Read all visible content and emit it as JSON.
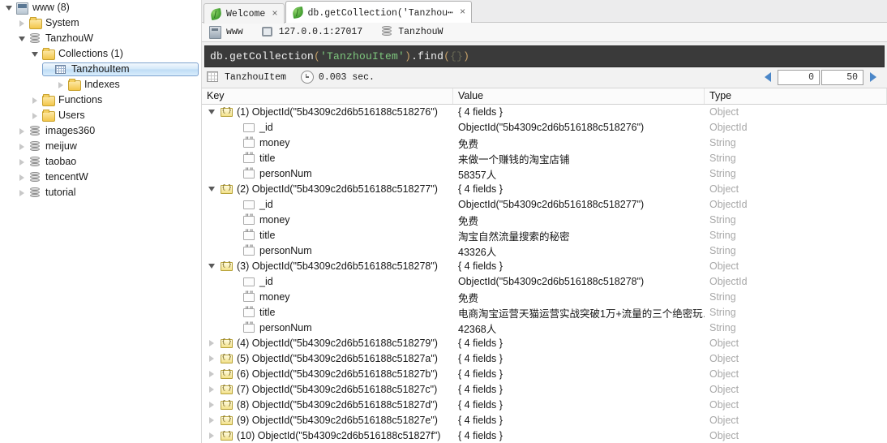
{
  "sidebar": {
    "items": [
      {
        "label": "www (8)",
        "icon": "server-icon",
        "indent": 0,
        "state": "expanded",
        "selected": false
      },
      {
        "label": "System",
        "icon": "folder-icon",
        "indent": 1,
        "state": "collapsed",
        "selected": false
      },
      {
        "label": "TanzhouW",
        "icon": "database-icon",
        "indent": 1,
        "state": "expanded",
        "selected": false
      },
      {
        "label": "Collections (1)",
        "icon": "folder-icon",
        "indent": 2,
        "state": "expanded",
        "selected": false
      },
      {
        "label": "TanzhouItem",
        "icon": "collection-icon",
        "indent": 3,
        "state": "expanded",
        "selected": true
      },
      {
        "label": "Indexes",
        "icon": "folder-icon",
        "indent": 4,
        "state": "collapsed",
        "selected": false
      },
      {
        "label": "Functions",
        "icon": "folder-icon",
        "indent": 2,
        "state": "collapsed",
        "selected": false
      },
      {
        "label": "Users",
        "icon": "folder-icon",
        "indent": 2,
        "state": "collapsed",
        "selected": false
      },
      {
        "label": "images360",
        "icon": "database-icon",
        "indent": 1,
        "state": "collapsed",
        "selected": false
      },
      {
        "label": "meijuw",
        "icon": "database-icon",
        "indent": 1,
        "state": "collapsed",
        "selected": false
      },
      {
        "label": "taobao",
        "icon": "database-icon",
        "indent": 1,
        "state": "collapsed",
        "selected": false
      },
      {
        "label": "tencentW",
        "icon": "database-icon",
        "indent": 1,
        "state": "collapsed",
        "selected": false
      },
      {
        "label": "tutorial",
        "icon": "database-icon",
        "indent": 1,
        "state": "collapsed",
        "selected": false
      }
    ]
  },
  "tabs": [
    {
      "label": "Welcome",
      "icon": "leaf-icon",
      "close": "×",
      "active": false
    },
    {
      "label": "db.getCollection('Tanzhou⋯",
      "icon": "leaf-icon",
      "close": "×",
      "active": true
    }
  ],
  "breadcrumb": [
    {
      "label": "www",
      "icon": "app-icon"
    },
    {
      "label": "127.0.0.1:27017",
      "icon": "monitor-icon"
    },
    {
      "label": "TanzhouW",
      "icon": "database-icon"
    }
  ],
  "editor": {
    "query_full": "db.getCollection('TanzhouItem').find({})",
    "tokens": [
      {
        "t": "db.getCollection",
        "c": "plain"
      },
      {
        "t": "(",
        "c": "paren"
      },
      {
        "t": "'TanzhouItem'",
        "c": "str"
      },
      {
        "t": ")",
        "c": "paren"
      },
      {
        "t": ".find",
        "c": "plain"
      },
      {
        "t": "(",
        "c": "paren"
      },
      {
        "t": "{}",
        "c": "brace"
      },
      {
        "t": ")",
        "c": "paren"
      }
    ]
  },
  "results_toolbar": {
    "collection": "TanzhouItem",
    "time": "0.003 sec.",
    "skip": "0",
    "limit": "50",
    "prev_icon": "arrow-left-icon",
    "next_icon": "arrow-right-icon"
  },
  "grid": {
    "columns": [
      "Key",
      "Value",
      "Type"
    ],
    "rows": [
      {
        "level": 0,
        "state": "expanded",
        "icon": "document-icon",
        "key": "(1) ObjectId(\"5b4309c2d6b516188c518276\")",
        "value": "{ 4 fields }",
        "type": "Object"
      },
      {
        "level": 1,
        "state": "leaf",
        "icon": "field-icon",
        "key": "_id",
        "value": "ObjectId(\"5b4309c2d6b516188c518276\")",
        "type": "ObjectId"
      },
      {
        "level": 1,
        "state": "leaf",
        "icon": "string-icon",
        "key": "money",
        "value": "免费",
        "type": "String"
      },
      {
        "level": 1,
        "state": "leaf",
        "icon": "string-icon",
        "key": "title",
        "value": "来做一个赚钱的淘宝店铺",
        "type": "String"
      },
      {
        "level": 1,
        "state": "leaf",
        "icon": "string-icon",
        "key": "personNum",
        "value": "58357人",
        "type": "String"
      },
      {
        "level": 0,
        "state": "expanded",
        "icon": "document-icon",
        "key": "(2) ObjectId(\"5b4309c2d6b516188c518277\")",
        "value": "{ 4 fields }",
        "type": "Object"
      },
      {
        "level": 1,
        "state": "leaf",
        "icon": "field-icon",
        "key": "_id",
        "value": "ObjectId(\"5b4309c2d6b516188c518277\")",
        "type": "ObjectId"
      },
      {
        "level": 1,
        "state": "leaf",
        "icon": "string-icon",
        "key": "money",
        "value": "免费",
        "type": "String"
      },
      {
        "level": 1,
        "state": "leaf",
        "icon": "string-icon",
        "key": "title",
        "value": "淘宝自然流量搜索的秘密",
        "type": "String"
      },
      {
        "level": 1,
        "state": "leaf",
        "icon": "string-icon",
        "key": "personNum",
        "value": "43326人",
        "type": "String"
      },
      {
        "level": 0,
        "state": "expanded",
        "icon": "document-icon",
        "key": "(3) ObjectId(\"5b4309c2d6b516188c518278\")",
        "value": "{ 4 fields }",
        "type": "Object"
      },
      {
        "level": 1,
        "state": "leaf",
        "icon": "field-icon",
        "key": "_id",
        "value": "ObjectId(\"5b4309c2d6b516188c518278\")",
        "type": "ObjectId"
      },
      {
        "level": 1,
        "state": "leaf",
        "icon": "string-icon",
        "key": "money",
        "value": "免费",
        "type": "String"
      },
      {
        "level": 1,
        "state": "leaf",
        "icon": "string-icon",
        "key": "title",
        "value": "电商淘宝运营天猫运营实战突破1万+流量的三个绝密玩…",
        "type": "String"
      },
      {
        "level": 1,
        "state": "leaf",
        "icon": "string-icon",
        "key": "personNum",
        "value": "42368人",
        "type": "String"
      },
      {
        "level": 0,
        "state": "collapsed",
        "icon": "document-icon",
        "key": "(4) ObjectId(\"5b4309c2d6b516188c518279\")",
        "value": "{ 4 fields }",
        "type": "Object"
      },
      {
        "level": 0,
        "state": "collapsed",
        "icon": "document-icon",
        "key": "(5) ObjectId(\"5b4309c2d6b516188c51827a\")",
        "value": "{ 4 fields }",
        "type": "Object"
      },
      {
        "level": 0,
        "state": "collapsed",
        "icon": "document-icon",
        "key": "(6) ObjectId(\"5b4309c2d6b516188c51827b\")",
        "value": "{ 4 fields }",
        "type": "Object"
      },
      {
        "level": 0,
        "state": "collapsed",
        "icon": "document-icon",
        "key": "(7) ObjectId(\"5b4309c2d6b516188c51827c\")",
        "value": "{ 4 fields }",
        "type": "Object"
      },
      {
        "level": 0,
        "state": "collapsed",
        "icon": "document-icon",
        "key": "(8) ObjectId(\"5b4309c2d6b516188c51827d\")",
        "value": "{ 4 fields }",
        "type": "Object"
      },
      {
        "level": 0,
        "state": "collapsed",
        "icon": "document-icon",
        "key": "(9) ObjectId(\"5b4309c2d6b516188c51827e\")",
        "value": "{ 4 fields }",
        "type": "Object"
      },
      {
        "level": 0,
        "state": "collapsed",
        "icon": "document-icon",
        "key": "(10) ObjectId(\"5b4309c2d6b516188c51827f\")",
        "value": "{ 4 fields }",
        "type": "Object"
      }
    ]
  },
  "colors": {
    "selection_border": "#7da2ce",
    "editor_bg": "#3a3a3a",
    "string_token": "#7ec87e",
    "type_text": "#a8a8a8",
    "pager_arrow": "#4a86c8"
  }
}
